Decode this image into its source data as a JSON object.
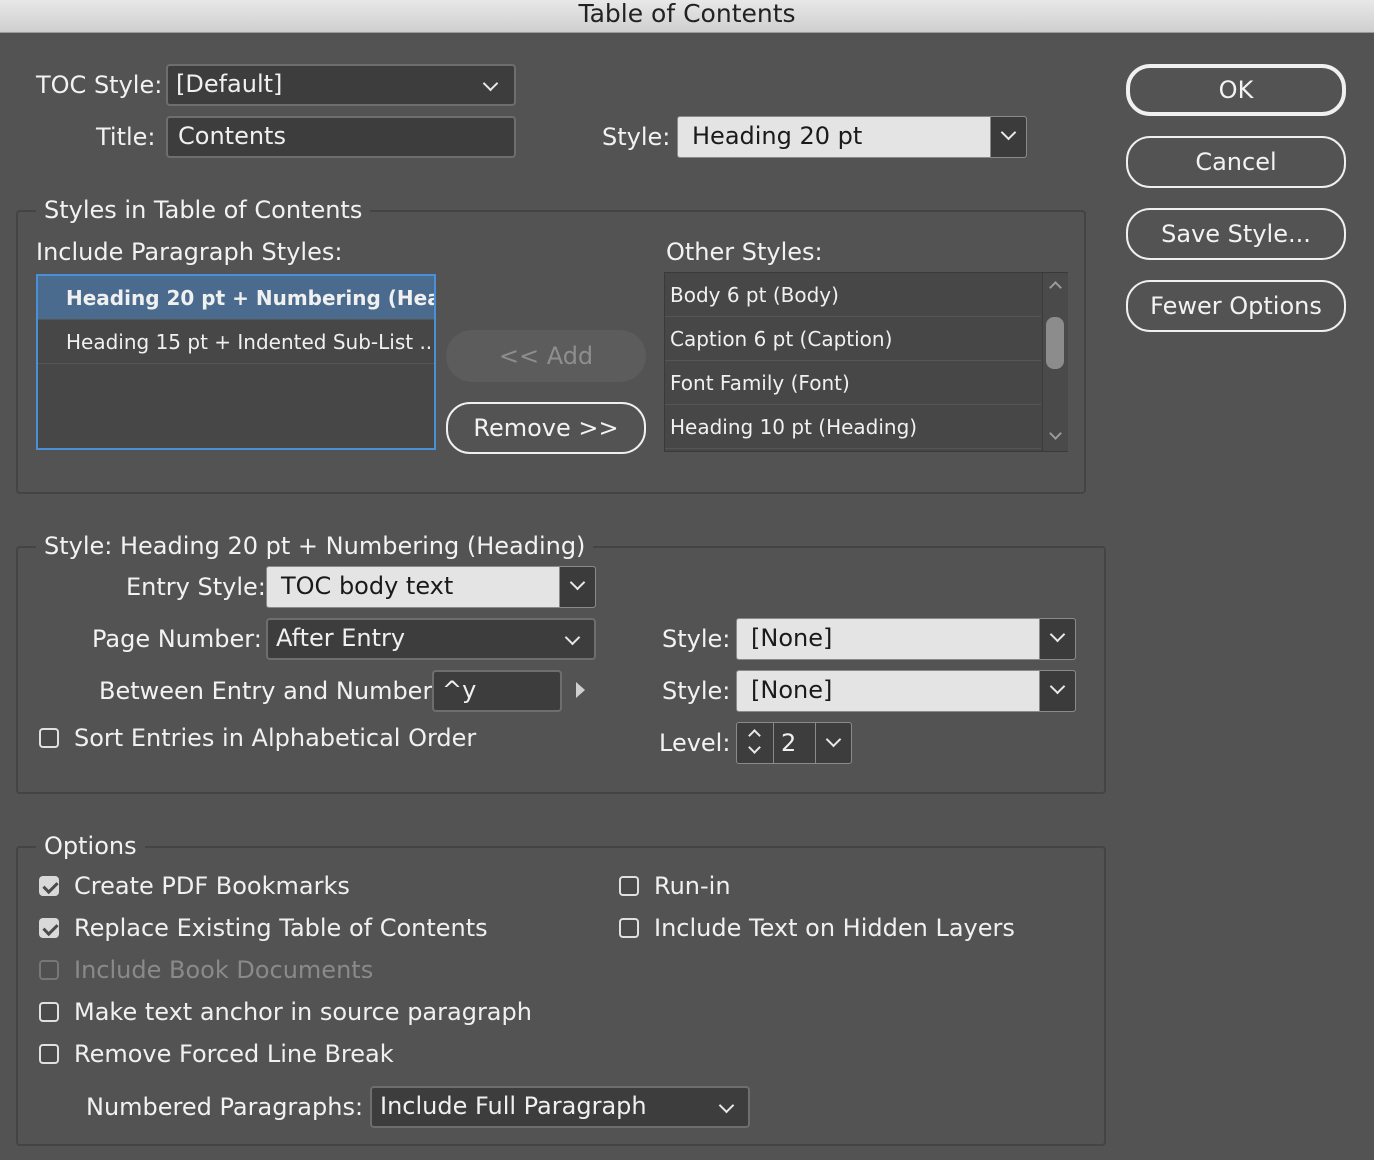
{
  "window": {
    "title": "Table of Contents"
  },
  "top": {
    "toc_style_label": "TOC Style:",
    "toc_style_value": "[Default]",
    "title_label": "Title:",
    "title_value": "Contents",
    "title_style_label": "Style:",
    "title_style_value": "Heading 20 pt"
  },
  "buttons": {
    "ok": "OK",
    "cancel": "Cancel",
    "save_style": "Save Style...",
    "fewer_options": "Fewer Options"
  },
  "styles_group": {
    "title": "Styles in Table of Contents",
    "include_label": "Include Paragraph Styles:",
    "include_items": [
      {
        "label": "Heading 20 pt + Numbering (Hea...",
        "selected": true
      },
      {
        "label": "Heading 15 pt + Indented Sub-List ...",
        "selected": false
      }
    ],
    "add_button": "<< Add",
    "remove_button": "Remove >>",
    "other_label": "Other Styles:",
    "other_items": [
      "Body 6 pt (Body)",
      "Caption 6 pt (Caption)",
      "Font Family (Font)",
      "Heading 10 pt (Heading)"
    ]
  },
  "style_group": {
    "title": "Style: Heading 20 pt + Numbering (Heading)",
    "entry_style_label": "Entry Style:",
    "entry_style_value": "TOC body text",
    "page_number_label": "Page Number:",
    "page_number_value": "After Entry",
    "page_number_style_label": "Style:",
    "page_number_style_value": "[None]",
    "between_label": "Between Entry and Number:",
    "between_value": "^y",
    "between_style_label": "Style:",
    "between_style_value": "[None]",
    "sort_label": "Sort Entries in Alphabetical Order",
    "sort_checked": false,
    "level_label": "Level:",
    "level_value": "2"
  },
  "options_group": {
    "title": "Options",
    "create_pdf_bookmarks": "Create PDF Bookmarks",
    "replace_existing": "Replace Existing Table of Contents",
    "include_book_documents": "Include Book Documents",
    "make_text_anchor": "Make text anchor in source paragraph",
    "remove_forced_line_break": "Remove Forced Line Break",
    "run_in": "Run-in",
    "include_hidden_layers": "Include Text on Hidden Layers",
    "numbered_paragraphs_label": "Numbered Paragraphs:",
    "numbered_paragraphs_value": "Include Full Paragraph"
  },
  "colors": {
    "background": "#535353",
    "selection": "#4a6b8e",
    "focus_ring": "#4a90d9"
  }
}
